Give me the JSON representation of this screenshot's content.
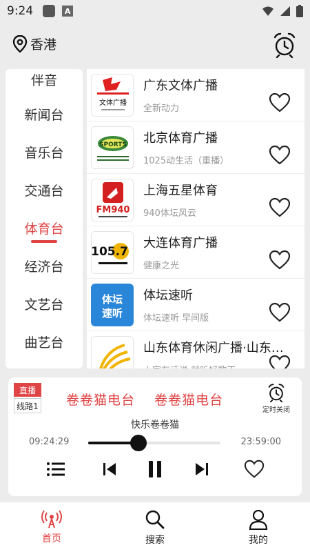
{
  "status_bar": {
    "time": "9:24"
  },
  "location": {
    "city": "香港"
  },
  "categories": [
    {
      "label": "伴音",
      "active": false
    },
    {
      "label": "新闻台",
      "active": false
    },
    {
      "label": "音乐台",
      "active": false
    },
    {
      "label": "交通台",
      "active": false
    },
    {
      "label": "体育台",
      "active": true
    },
    {
      "label": "经济台",
      "active": false
    },
    {
      "label": "文艺台",
      "active": false
    },
    {
      "label": "曲艺台",
      "active": false
    }
  ],
  "stations": [
    {
      "name": "广东文体广播",
      "subtitle": "全新动力",
      "logo_icon": "guangdong-sports-logo",
      "logo_text": "文体广播"
    },
    {
      "name": "北京体育广播",
      "subtitle": "1025动生活（重播）",
      "logo_icon": "beijing-sports-logo",
      "logo_text": "SPORTS"
    },
    {
      "name": "上海五星体育",
      "subtitle": "940体坛风云",
      "logo_icon": "shanghai-fm940-logo",
      "logo_text": "FM940"
    },
    {
      "name": "大连体育广播",
      "subtitle": "健康之光",
      "logo_icon": "dalian-1057-logo",
      "logo_text": "105.7"
    },
    {
      "name": "体坛速听",
      "subtitle": "体坛速听 早间版",
      "logo_icon": "titan-sutng-logo",
      "logo_text": "体坛速听"
    },
    {
      "name": "山东体育休闲广播·山东…",
      "subtitle": "上官有话说 就听好歌不…",
      "logo_icon": "shandong-sports-logo",
      "logo_text": ""
    }
  ],
  "player": {
    "live_badge": "直播",
    "line_badge": "线路1",
    "scroll_title": "卷卷猫电台    卷卷猫电台",
    "timer_label": "定时关闭",
    "now_playing": "快乐卷卷猫",
    "time_current": "09:24:29",
    "time_end": "23:59:00",
    "progress": 0.38
  },
  "bottom_nav": [
    {
      "label": "首页",
      "icon": "radio-broadcast-icon",
      "active": true
    },
    {
      "label": "搜索",
      "icon": "search-icon",
      "active": false
    },
    {
      "label": "我的",
      "icon": "user-icon",
      "active": false
    }
  ],
  "colors": {
    "accent": "#e04545",
    "background": "#ececec"
  }
}
